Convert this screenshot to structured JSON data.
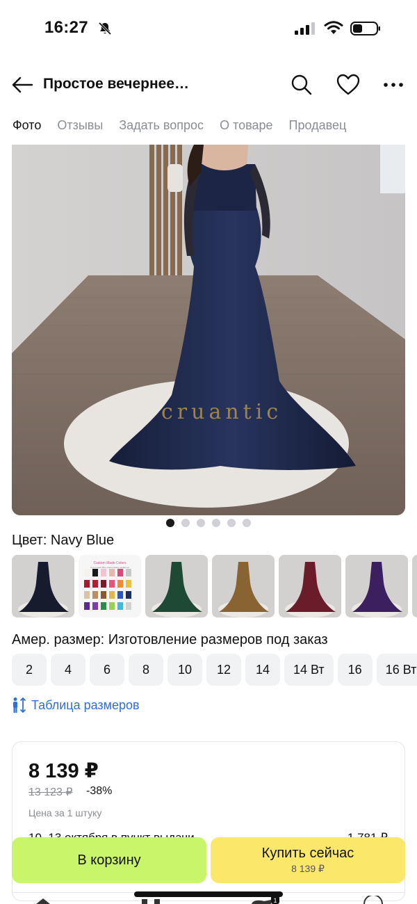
{
  "status": {
    "time": "16:27"
  },
  "header": {
    "title": "Простое вечернее…"
  },
  "tabs": [
    "Фото",
    "Отзывы",
    "Задать вопрос",
    "О товаре",
    "Продавец"
  ],
  "photo": {
    "watermark": "cruantic",
    "pages": 6,
    "active_page": 1
  },
  "color": {
    "label": "Цвет: Navy Blue"
  },
  "swatch_chart": {
    "title": "Custom Made Colors",
    "note": "If you need other colors please contact us"
  },
  "size": {
    "label": "Амер. размер: Изготовление размеров под заказ",
    "options": [
      "2",
      "4",
      "6",
      "8",
      "10",
      "12",
      "14",
      "14 Вт",
      "16",
      "16 Вт"
    ]
  },
  "size_table": {
    "label": "Таблица размеров"
  },
  "price": {
    "current": "8 139 ₽",
    "old": "13 123 ₽",
    "discount": "-38%",
    "unit": "Цена за 1 штуку",
    "delivery": "10–13 октября в пункт выдачи",
    "delivery_price": "1 781 ₽"
  },
  "actions": {
    "cart": "В корзину",
    "buy": "Купить сейчас",
    "buy_price": "8 139 ₽"
  },
  "nav": {
    "cart_badge": "1"
  },
  "colors": {
    "navy": "#1f2a4d",
    "cart_button": "#c9f56a",
    "buy_button": "#fbe86a",
    "link": "#2e6fd8"
  }
}
